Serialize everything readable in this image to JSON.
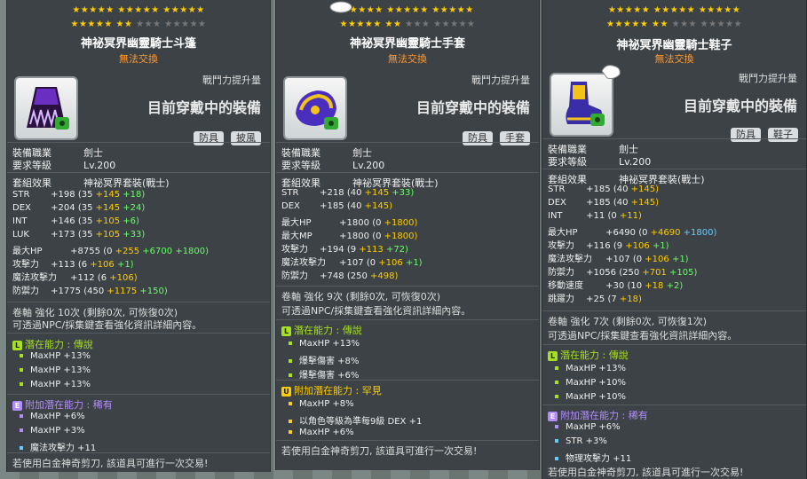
{
  "panels": [
    {
      "stars_row1": "★★★★★  ★★★★★  ★★★★★",
      "stars_row2a": "★★★★★  ★★",
      "stars_row2b": "★★★  ★★★★★",
      "title": "神祕冥界幽靈騎士斗篷",
      "trade": "無法交換",
      "combat": "戰鬥力提升量",
      "equipped": "目前穿戴中的裝備",
      "tags": [
        "防具",
        "披風"
      ],
      "job_label": "裝備職業",
      "job": "劍士",
      "level_label": "要求等級",
      "level": "Lv.200",
      "set_label": "套組效果",
      "set": "神祕冥界套裝(戰士)",
      "stats": [
        {
          "k": "STR",
          "v": "+198",
          "base": "(35",
          "a": "+145",
          "b": "+18)"
        },
        {
          "k": "DEX",
          "v": "+204",
          "base": "(35",
          "a": "+145",
          "b": "+24)"
        },
        {
          "k": "INT",
          "v": "+146",
          "base": "(35",
          "a": "+105",
          "b": "+6)"
        },
        {
          "k": "LUK",
          "v": "+173",
          "base": "(35",
          "a": "+105",
          "b": "+33)"
        },
        {
          "k": "最大HP",
          "v": "+8755",
          "base": "(0",
          "a": "+255",
          "b": "+6700",
          "c": "+1800)"
        },
        {
          "k": "攻擊力",
          "v": "+113",
          "base": "(6",
          "a": "+106",
          "b": "+1)"
        },
        {
          "k": "魔法攻擊力",
          "v": "+112",
          "base": "(6",
          "a": "+106)"
        },
        {
          "k": "防禦力",
          "v": "+1775",
          "base": "(450",
          "a": "+1175",
          "b": "+150)"
        }
      ],
      "scroll": "卷軸 強化 10次 (剩餘0次, 可恢復0次)",
      "npc": "可透過NPC/採集鍵查看強化資訊詳細內容。",
      "pot_title": "潛在能力 : 傳說",
      "pot": [
        "MaxHP +13%",
        "MaxHP +13%",
        "MaxHP +13%"
      ],
      "add_title": "附加潛在能力 : 稀有",
      "add": [
        "MaxHP +6%",
        "MaxHP +3%",
        "魔法攻擊力 +11"
      ],
      "footer": "若使用白金神奇剪刀, 該道具可進行一次交易!"
    },
    {
      "stars_row1": "★★★★★  ★★★★★  ★★★★★",
      "stars_row2a": "★★★★★  ★★",
      "stars_row2b": "★★★  ★★★★★",
      "title": "神祕冥界幽靈騎士手套",
      "trade": "無法交換",
      "combat": "戰鬥力提升量",
      "equipped": "目前穿戴中的裝備",
      "tags": [
        "防具",
        "手套"
      ],
      "job_label": "裝備職業",
      "job": "劍士",
      "level_label": "要求等級",
      "level": "Lv.200",
      "set_label": "套組效果",
      "set": "神祕冥界套裝(戰士)",
      "stats": [
        {
          "k": "STR",
          "v": "+218",
          "base": "(40",
          "a": "+145",
          "b": "+33)"
        },
        {
          "k": "DEX",
          "v": "+185",
          "base": "(40",
          "a": "+145)"
        },
        {
          "k": "最大HP",
          "v": "+1800",
          "base": "(0",
          "a": "+1800)"
        },
        {
          "k": "最大MP",
          "v": "+1800",
          "base": "(0",
          "a": "+1800)"
        },
        {
          "k": "攻擊力",
          "v": "+194",
          "base": "(9",
          "a": "+113",
          "b": "+72)"
        },
        {
          "k": "魔法攻擊力",
          "v": "+107",
          "base": "(0",
          "a": "+106",
          "b": "+1)"
        },
        {
          "k": "防禦力",
          "v": "+748",
          "base": "(250",
          "a": "+498)"
        }
      ],
      "scroll": "卷軸 強化 9次 (剩餘0次, 可恢復0次)",
      "npc": "可透過NPC/採集鍵查看強化資訊詳細內容。",
      "pot_title": "潛在能力 : 傳說",
      "pot": [
        "MaxHP +13%",
        "爆擊傷害 +8%",
        "爆擊傷害 +6%"
      ],
      "add_title": "附加潛在能力 : 罕見",
      "add": [
        "MaxHP +8%",
        "以角色等級為準每9級 DEX +1",
        "MaxHP +6%"
      ],
      "footer": "若使用白金神奇剪刀, 該道具可進行一次交易!"
    },
    {
      "stars_row1": "★★★★★  ★★★★★  ★★★★★",
      "stars_row2a": "★★★★★  ★★",
      "stars_row2b": "★★★  ★★★★★",
      "title": "神祕冥界幽靈騎士鞋子",
      "trade": "無法交換",
      "combat": "戰鬥力提升量",
      "equipped": "目前穿戴中的裝備",
      "tags": [
        "防具",
        "鞋子"
      ],
      "job_label": "裝備職業",
      "job": "劍士",
      "level_label": "要求等級",
      "level": "Lv.200",
      "set_label": "套組效果",
      "set": "神祕冥界套裝(戰士)",
      "stats": [
        {
          "k": "STR",
          "v": "+185",
          "base": "(40",
          "a": "+145)"
        },
        {
          "k": "DEX",
          "v": "+185",
          "base": "(40",
          "a": "+145)"
        },
        {
          "k": "INT",
          "v": "+11",
          "base": "(0",
          "a": "+11)"
        },
        {
          "k": "最大HP",
          "v": "+6490",
          "base": "(0",
          "a": "+4690",
          "b": "+1800)"
        },
        {
          "k": "攻擊力",
          "v": "+116",
          "base": "(9",
          "a": "+106",
          "b": "+1)"
        },
        {
          "k": "魔法攻擊力",
          "v": "+107",
          "base": "(0",
          "a": "+106",
          "b": "+1)"
        },
        {
          "k": "防禦力",
          "v": "+1056",
          "base": "(250",
          "a": "+701",
          "b": "+105)"
        },
        {
          "k": "移動速度",
          "v": "+30",
          "base": "(10",
          "a": "+18",
          "b": "+2)"
        },
        {
          "k": "跳躍力",
          "v": "+25",
          "base": "(7",
          "a": "+18)"
        }
      ],
      "scroll": "卷軸 強化 7次 (剩餘0次, 可恢復1次)",
      "npc": "可透過NPC/採集鍵查看強化資訊詳細內容。",
      "pot_title": "潛在能力 : 傳說",
      "pot": [
        "MaxHP +13%",
        "MaxHP +10%",
        "MaxHP +10%"
      ],
      "add_title": "附加潛在能力 : 稀有",
      "add": [
        "MaxHP +6%",
        "STR +3%",
        "物理攻擊力 +11"
      ],
      "footer": "若使用白金神奇剪刀, 該道具可進行一次交易!"
    }
  ],
  "badges": {
    "legend": "L",
    "unique": "U",
    "rare": "E"
  }
}
